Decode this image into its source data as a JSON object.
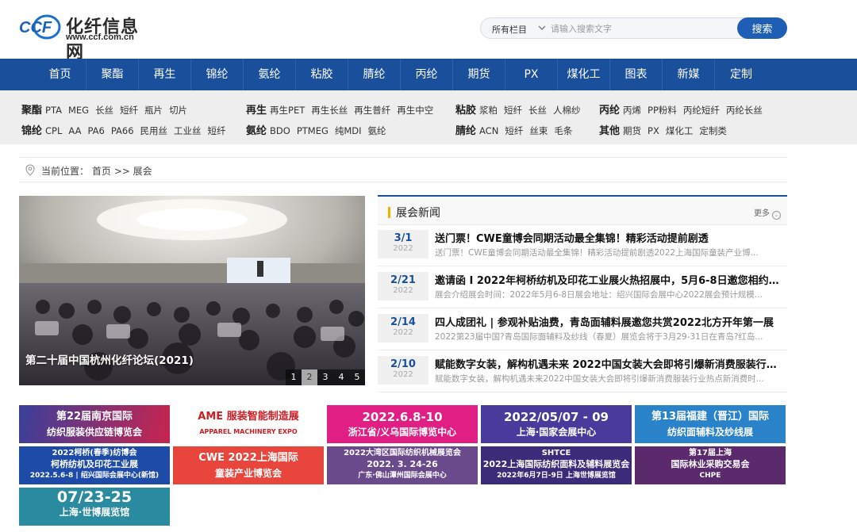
{
  "logo": {
    "cn": "化纤信息网",
    "url": "www.ccf.com.cn",
    "mark": "CCF"
  },
  "search": {
    "category": "所有栏目",
    "placeholder": "请输入搜索文字",
    "button": "搜索"
  },
  "nav": [
    "首页",
    "聚酯",
    "再生",
    "锦纶",
    "氨纶",
    "粘胶",
    "腈纶",
    "丙纶",
    "期货",
    "PX",
    "煤化工",
    "图表",
    "新媒",
    "定制"
  ],
  "subnav": [
    {
      "head": "聚酯",
      "items": [
        "PTA",
        "MEG",
        "长丝",
        "短纤",
        "瓶片",
        "切片"
      ]
    },
    {
      "head": "再生",
      "items": [
        "再生PET",
        "再生长丝",
        "再生普纤",
        "再生中空"
      ]
    },
    {
      "head": "粘胶",
      "items": [
        "浆粕",
        "短纤",
        "长丝",
        "人棉纱"
      ]
    },
    {
      "head": "丙纶",
      "items": [
        "丙烯",
        "PP粉料",
        "丙纶短纤",
        "丙纶长丝"
      ]
    },
    {
      "head": "锦纶",
      "items": [
        "CPL",
        "AA",
        "PA6",
        "PA66",
        "民用丝",
        "工业丝",
        "短纤"
      ]
    },
    {
      "head": "氨纶",
      "items": [
        "BDO",
        "PTMEG",
        "纯MDI",
        "氨纶"
      ]
    },
    {
      "head": "腈纶",
      "items": [
        "ACN",
        "短纤",
        "丝束",
        "毛条"
      ]
    },
    {
      "head": "其他",
      "items": [
        "期货",
        "PX",
        "煤化工",
        "定制类"
      ]
    }
  ],
  "breadcrumb": {
    "label": "当前位置：",
    "home": "首页",
    "sep": ">>",
    "current": "展会"
  },
  "slider": {
    "caption": "第二十届中国杭州化纤论坛(2021)",
    "dots": [
      "1",
      "2",
      "3",
      "4",
      "5"
    ],
    "active": 2
  },
  "news": {
    "title": "展会新闻",
    "more": "更多",
    "items": [
      {
        "day": "3/1",
        "year": "2022",
        "headline": "送门票！CWE童博会同期活动最全集锦！精彩活动提前剧透",
        "summary": "送门票！CWE童博会同期活动最全集锦！精彩活动提前剧透2022上海国际童装产业博..."
      },
      {
        "day": "2/21",
        "year": "2022",
        "headline": "邀请函 I 2022年柯桥纺机及印花工业展火热招展中，5月6-8日邀您相约绍...",
        "summary": "展会介绍展会时间：2022年5月6-8日展会地址：绍兴国际会展中心2022展会预计规模..."
      },
      {
        "day": "2/14",
        "year": "2022",
        "headline": "四人成团礼 | 参观补贴油费，青岛面辅料展邀您共赏2022北方开年第一展",
        "summary": "2022第23届中国?青岛国际面辅料及纱线（春夏）展览会将于3月29-31日在青岛?红岛..."
      },
      {
        "day": "2/10",
        "year": "2022",
        "headline": "赋能数字女装，解构机遇未来 2022中国女装大会即将引爆新消费服装行业...",
        "summary": "赋能数字女装，解构机遇未来2022中国女装大会即将引爆新消费服装行业热点新消费时..."
      }
    ]
  },
  "ads": [
    {
      "l1": "第22届南京国际",
      "l2": "纺织服装供应链博览会",
      "bg": "#3a3f9a",
      "bg2": "#c8244f"
    },
    {
      "l1": "AME 服装智能制造展",
      "l2": "APPAREL MACHINERY EXPO",
      "bg": "#ffffff",
      "fg": "#d01c24"
    },
    {
      "l1": "2022.6.8-10",
      "l2": "浙江省/义乌国际博览中心",
      "bg": "#e11e83"
    },
    {
      "l1": "2022/05/07 - 09",
      "l2": "上海·国家会展中心",
      "bg": "#4a3a9c"
    },
    {
      "l1": "第13届福建（晋江）国际",
      "l2": "纺织面辅料及纱线展",
      "bg": "#2a82c8"
    },
    {
      "l1": "2022柯桥(春季)纺博会",
      "l2": "柯桥纺机及印花工业展",
      "l3": "2022.5.6-8 | 绍兴国际会展中心(新馆)",
      "bg": "#1e4aa8"
    },
    {
      "l1": "CWE 2022上海国际",
      "l2": "童装产业博览会",
      "bg": "#e8453c"
    },
    {
      "l1": "2022大湾区国际纺织机械展览会",
      "l2": "2022. 3. 24-26",
      "l3": "广东·佛山潭州国际会展中心",
      "bg": "#6b4a8c"
    },
    {
      "l1": "SHTCE",
      "l2": "2022上海国际纺织面料及辅料展览会",
      "l3": "2022年6月7日-9日 上海世博展览馆",
      "bg": "#3b2c7a"
    },
    {
      "l1": "第17届上海",
      "l2": "国际林业采购交易会",
      "l3": "CHPE",
      "bg": "#5a2a6c"
    },
    {
      "l1": "07/23-25",
      "l2": "上海·世博展览馆",
      "bg": "#2a8aa0"
    }
  ],
  "colors": {
    "brand": "#1a4f9c",
    "accent": "#1e5fb5",
    "date": "#1a4f9c",
    "titleBar": "#f0b400"
  }
}
